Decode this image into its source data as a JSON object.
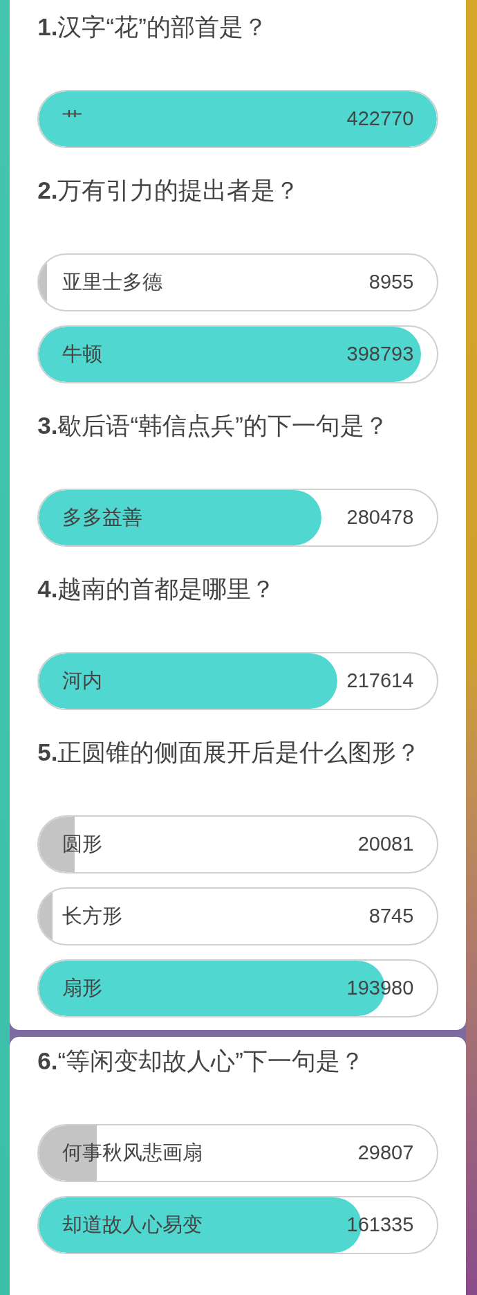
{
  "cards": [
    {
      "questions": [
        {
          "text": "**1.**汉字“花”的部首是？",
          "options": [
            {
              "label": "艹",
              "count": "422770",
              "level": 1,
              "correct": true
            }
          ]
        },
        {
          "text": "**2.**万有引力的提出者是？",
          "options": [
            {
              "label": "亚里士多德",
              "count": "8955",
              "level": 0.02,
              "correct": false
            },
            {
              "label": "牛顿",
              "count": "398793",
              "level": 0.96,
              "correct": true
            }
          ]
        },
        {
          "text": "**3.**歇后语“韩信点兵”的下一句是？",
          "options": [
            {
              "label": "多多益善",
              "count": "280478",
              "level": 0.71,
              "correct": true
            }
          ]
        },
        {
          "text": "**4.**越南的首都是哪里？",
          "options": [
            {
              "label": "河内",
              "count": "217614",
              "level": 0.75,
              "correct": true
            }
          ]
        },
        {
          "text": "**5.**正圆锥的侧面展开后是什么图形？",
          "options": [
            {
              "label": "圆形",
              "count": "20081",
              "level": 0.09,
              "correct": false
            },
            {
              "label": "长方形",
              "count": "8745",
              "level": 0.035,
              "correct": false
            },
            {
              "label": "扇形",
              "count": "193980",
              "level": 0.87,
              "correct": true
            }
          ]
        }
      ]
    },
    {
      "questions": [
        {
          "text": "**6.**“等闲变却故人心”下一句是？",
          "options": [
            {
              "label": "何事秋风悲画扇",
              "count": "29807",
              "level": 0.145,
              "correct": false
            },
            {
              "label": "却道故人心易变",
              "count": "161335",
              "level": 0.81,
              "correct": true
            }
          ]
        }
      ]
    }
  ]
}
